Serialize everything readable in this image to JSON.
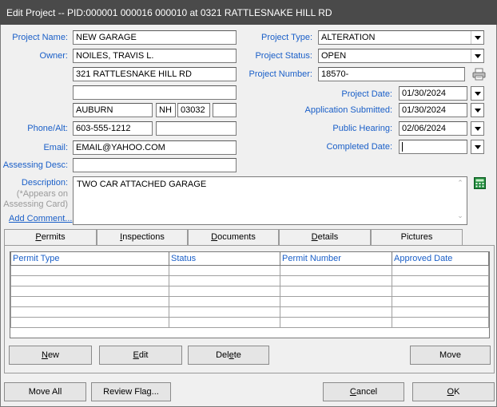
{
  "window": {
    "title": "Edit Project -- PID:000001 000016 000010 at 0321 RATTLESNAKE HILL RD"
  },
  "left": {
    "project_name_label": "Project Name:",
    "project_name": "NEW GARAGE",
    "owner_label": "Owner:",
    "owner": "NOILES, TRAVIS L.",
    "address1": "321 RATTLESNAKE HILL RD",
    "address2": "",
    "city": "AUBURN",
    "state": "NH",
    "zip": "03032",
    "zip_ext": "",
    "phone_label": "Phone/Alt:",
    "phone": "603-555-1212",
    "phone_alt": "",
    "email_label": "Email:",
    "email": "EMAIL@YAHOO.COM",
    "assessing_desc_label": "Assessing Desc:",
    "assessing_desc": "",
    "description_label": "Description:",
    "description_note1": "(*Appears on",
    "description_note2": "Assessing Card)",
    "description": "TWO CAR ATTACHED GARAGE",
    "add_comment": "Add Comment..."
  },
  "right": {
    "project_type_label": "Project Type:",
    "project_type": "ALTERATION",
    "project_status_label": "Project Status:",
    "project_status": "OPEN",
    "project_number_label": "Project Number:",
    "project_number": "18570-",
    "project_date_label": "Project Date:",
    "project_date": "01/30/2024",
    "application_submitted_label": "Application Submitted:",
    "application_submitted": "01/30/2024",
    "public_hearing_label": "Public Hearing:",
    "public_hearing": "02/06/2024",
    "completed_date_label": "Completed Date:",
    "completed_date": ""
  },
  "tabs": [
    {
      "label": "Permits",
      "key": "P",
      "rest": "ermits"
    },
    {
      "label": "Inspections",
      "key": "I",
      "rest": "nspections"
    },
    {
      "label": "Documents",
      "key": "D",
      "rest": "ocuments"
    },
    {
      "label": "Details",
      "key": "D",
      "rest": "etails"
    },
    {
      "label": "Pictures",
      "key": "",
      "rest": "Pictures"
    }
  ],
  "grid": {
    "columns": [
      "Permit Type",
      "Status",
      "Permit Number",
      "Approved Date"
    ],
    "rows": [
      [
        "",
        "",
        "",
        ""
      ],
      [
        "",
        "",
        "",
        ""
      ],
      [
        "",
        "",
        "",
        ""
      ],
      [
        "",
        "",
        "",
        ""
      ],
      [
        "",
        "",
        "",
        ""
      ],
      [
        "",
        "",
        "",
        ""
      ]
    ]
  },
  "panel_buttons": {
    "new_key": "N",
    "new_rest": "ew",
    "edit_key": "E",
    "edit_rest": "dit",
    "delete_pre": "Del",
    "delete_key": "e",
    "delete_rest": "te",
    "move": "Move"
  },
  "footer_buttons": {
    "move_all": "Move All",
    "review_flag": "Review Flag...",
    "cancel_key": "C",
    "cancel_rest": "ancel",
    "ok_key": "O",
    "ok_rest": "K"
  },
  "colors": {
    "label": "#1a5fc8",
    "titlebar": "#4a4a4a"
  }
}
